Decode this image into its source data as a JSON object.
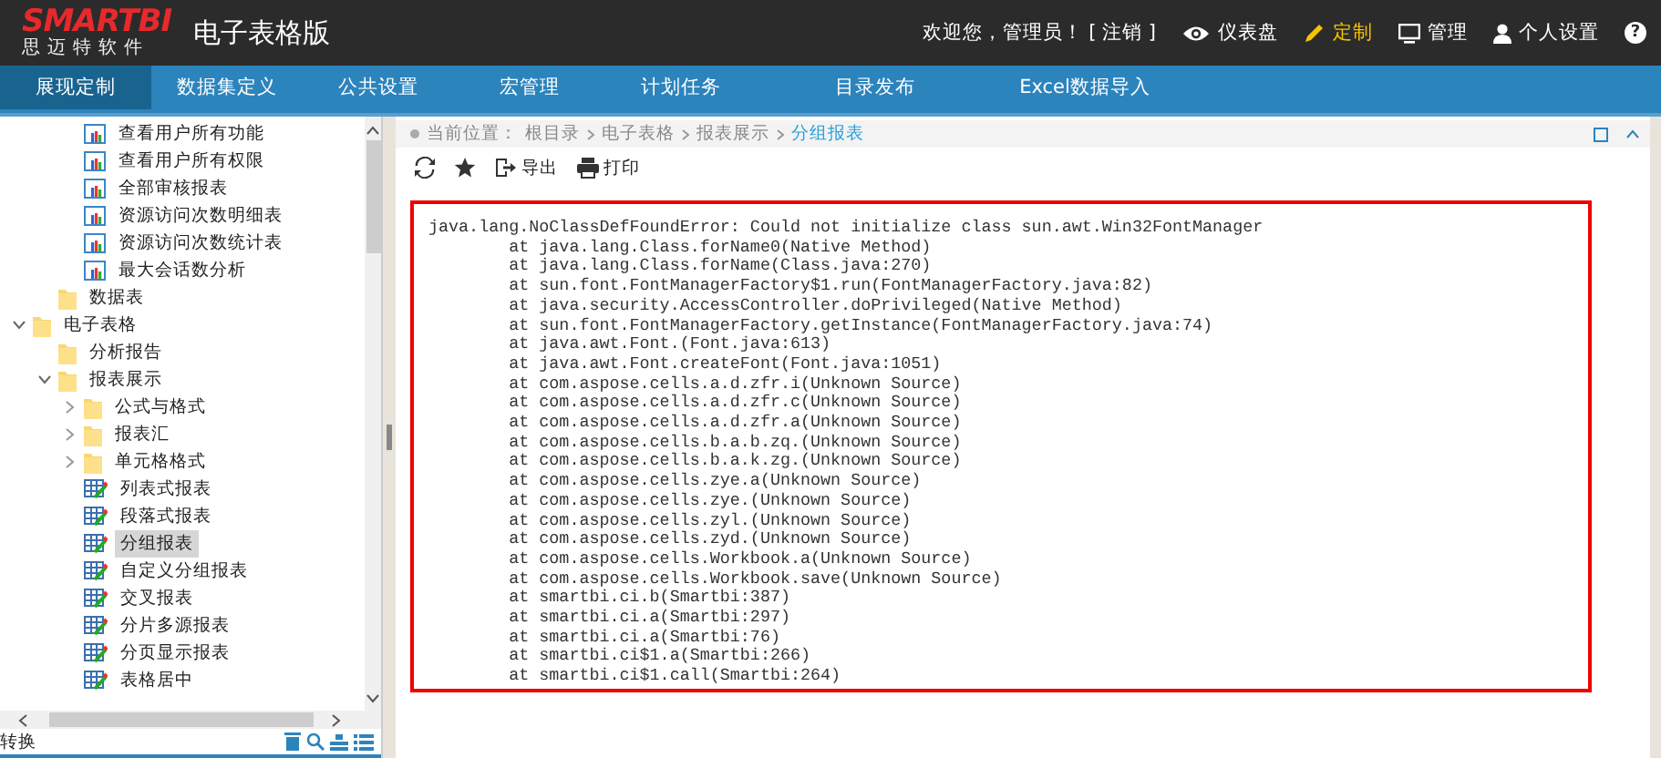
{
  "header": {
    "logo": "SMARTBI",
    "logo_subtitle": "思迈特软件",
    "product": "电子表格版",
    "welcome": "欢迎您，管理员！",
    "logout": "[ 注销 ]",
    "links": [
      {
        "label": "仪表盘",
        "selected": false
      },
      {
        "label": "定制",
        "selected": true
      },
      {
        "label": "管理",
        "selected": false
      },
      {
        "label": "个人设置",
        "selected": false
      }
    ],
    "help": "?"
  },
  "nav": [
    {
      "label": "展现定制",
      "selected": true
    },
    {
      "label": "数据集定义",
      "selected": false
    },
    {
      "label": "公共设置",
      "selected": false
    },
    {
      "label": "宏管理",
      "selected": false
    },
    {
      "label": "计划任务",
      "selected": false
    },
    {
      "label": "目录发布",
      "selected": false
    },
    {
      "label": "Excel数据导入",
      "selected": false
    }
  ],
  "tree": [
    {
      "children": [
        {
          "children": [
            {
              "label": "查看用户所有功能",
              "kind": "chart",
              "selected": false
            },
            {
              "label": "查看用户所有权限",
              "kind": "chart",
              "selected": false
            },
            {
              "label": "全部审核报表",
              "kind": "chart",
              "selected": false
            },
            {
              "label": "资源访问次数明细表",
              "kind": "chart",
              "selected": false
            },
            {
              "label": "资源访问次数统计表",
              "kind": "chart",
              "selected": false
            },
            {
              "label": "最大会话数分析",
              "kind": "chart",
              "selected": false
            }
          ]
        },
        {
          "label": "数据表",
          "kind": "folder",
          "selected": false
        }
      ]
    },
    {
      "label": "电子表格",
      "kind": "folder",
      "expanded": true,
      "selected": false,
      "children": [
        {
          "label": "分析报告",
          "kind": "folder",
          "selected": false
        },
        {
          "label": "报表展示",
          "kind": "folder",
          "expanded": true,
          "selected": false,
          "children": [
            {
              "label": "公式与格式",
              "kind": "folder",
              "expanded": false,
              "selected": false
            },
            {
              "label": "报表汇",
              "kind": "folder",
              "expanded": false,
              "selected": false
            },
            {
              "label": "单元格格式",
              "kind": "folder",
              "expanded": false,
              "selected": false
            },
            {
              "label": "列表式报表",
              "kind": "sheet",
              "selected": false
            },
            {
              "label": "段落式报表",
              "kind": "sheet",
              "selected": false
            },
            {
              "label": "分组报表",
              "kind": "sheet",
              "selected": true
            },
            {
              "label": "自定义分组报表",
              "kind": "sheet",
              "selected": false
            },
            {
              "label": "交叉报表",
              "kind": "sheet",
              "selected": false
            },
            {
              "label": "分片多源报表",
              "kind": "sheet",
              "selected": false
            },
            {
              "label": "分页显示报表",
              "kind": "sheet",
              "selected": false
            },
            {
              "label": "表格居中",
              "kind": "sheet",
              "selected": false
            }
          ]
        }
      ]
    }
  ],
  "tree_footer": {
    "label": "转换"
  },
  "breadcrumb": {
    "prefix": "当前位置：",
    "path": [
      "根目录",
      "电子表格",
      "报表展示"
    ],
    "current": "分组报表"
  },
  "toolbar": {
    "buttons": [
      "导出",
      "打印"
    ]
  },
  "error_lines": [
    "java.lang.NoClassDefFoundError: Could not initialize class sun.awt.Win32FontManager",
    "\tat java.lang.Class.forName0(Native Method)",
    "\tat java.lang.Class.forName(Class.java:270)",
    "\tat sun.font.FontManagerFactory$1.run(FontManagerFactory.java:82)",
    "\tat java.security.AccessController.doPrivileged(Native Method)",
    "\tat sun.font.FontManagerFactory.getInstance(FontManagerFactory.java:74)",
    "\tat java.awt.Font.(Font.java:613)",
    "\tat java.awt.Font.createFont(Font.java:1051)",
    "\tat com.aspose.cells.a.d.zfr.i(Unknown Source)",
    "\tat com.aspose.cells.a.d.zfr.c(Unknown Source)",
    "\tat com.aspose.cells.a.d.zfr.a(Unknown Source)",
    "\tat com.aspose.cells.b.a.b.zq.(Unknown Source)",
    "\tat com.aspose.cells.b.a.k.zg.(Unknown Source)",
    "\tat com.aspose.cells.zye.a(Unknown Source)",
    "\tat com.aspose.cells.zye.(Unknown Source)",
    "\tat com.aspose.cells.zyl.(Unknown Source)",
    "\tat com.aspose.cells.zyd.(Unknown Source)",
    "\tat com.aspose.cells.Workbook.a(Unknown Source)",
    "\tat com.aspose.cells.Workbook.save(Unknown Source)",
    "\tat smartbi.ci.b(Smartbi:387)",
    "\tat smartbi.ci.a(Smartbi:297)",
    "\tat smartbi.ci.a(Smartbi:76)",
    "\tat smartbi.ci$1.a(Smartbi:266)",
    "\tat smartbi.ci$1.call(Smartbi:264)"
  ]
}
